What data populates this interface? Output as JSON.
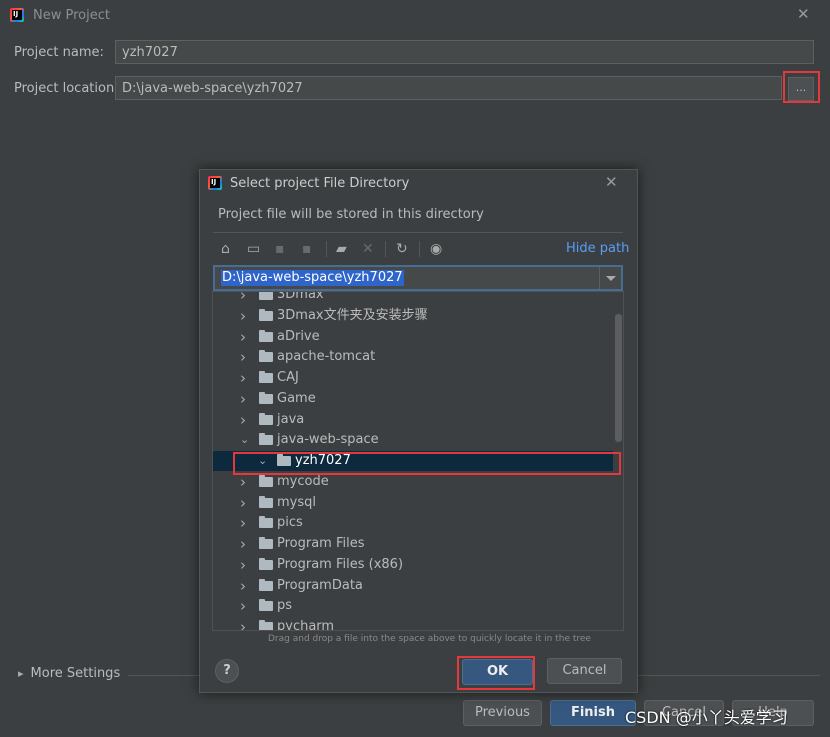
{
  "window": {
    "title": "New Project",
    "logo_text": "IJ",
    "close_glyph": "✕"
  },
  "form": {
    "name_label": "Project name:",
    "name_value": "yzh7027",
    "location_label": "Project location:",
    "location_value": "D:\\java-web-space\\yzh7027",
    "browse_label": "..."
  },
  "more_settings": {
    "label": "More Settings",
    "chevron_glyph": "▸"
  },
  "footer": {
    "previous": "Previous",
    "finish": "Finish",
    "cancel": "Cancel",
    "help": "Help"
  },
  "dialog": {
    "title": "Select project File Directory",
    "logo_text": "IJ",
    "close_glyph": "✕",
    "description": "Project file will be stored in this directory",
    "hide_path": "Hide path",
    "path_value": "D:\\java-web-space\\yzh7027",
    "hint": "Drag and drop a file into the space above to quickly locate it in the tree",
    "help_glyph": "?",
    "ok": "OK",
    "cancel": "Cancel",
    "toolbar": [
      {
        "icon": "home-icon",
        "glyph": "⌂",
        "enabled": true
      },
      {
        "icon": "desktop-icon",
        "glyph": "▭",
        "enabled": true
      },
      {
        "icon": "project-folder-icon",
        "glyph": "▪",
        "enabled": false
      },
      {
        "icon": "module-folder-icon",
        "glyph": "▪",
        "enabled": false
      },
      {
        "icon": "new-folder-icon",
        "glyph": "▰",
        "enabled": true
      },
      {
        "icon": "delete-icon",
        "glyph": "✕",
        "enabled": false
      },
      {
        "icon": "refresh-icon",
        "glyph": "↻",
        "enabled": true
      },
      {
        "icon": "show-hidden-icon",
        "glyph": "◉",
        "enabled": true
      }
    ],
    "tree": [
      {
        "label": "3Dmax",
        "level": 1,
        "expanded": false
      },
      {
        "label": "3Dmax文件夹及安装步骤",
        "level": 1,
        "expanded": false
      },
      {
        "label": "aDrive",
        "level": 1,
        "expanded": false
      },
      {
        "label": "apache-tomcat",
        "level": 1,
        "expanded": false
      },
      {
        "label": "CAJ",
        "level": 1,
        "expanded": false
      },
      {
        "label": "Game",
        "level": 1,
        "expanded": false
      },
      {
        "label": "java",
        "level": 1,
        "expanded": false
      },
      {
        "label": "java-web-space",
        "level": 1,
        "expanded": true
      },
      {
        "label": "yzh7027",
        "level": 2,
        "expanded": true,
        "selected": true
      },
      {
        "label": "mycode",
        "level": 1,
        "expanded": false
      },
      {
        "label": "mysql",
        "level": 1,
        "expanded": false
      },
      {
        "label": "pics",
        "level": 1,
        "expanded": false
      },
      {
        "label": "Program Files",
        "level": 1,
        "expanded": false
      },
      {
        "label": "Program Files (x86)",
        "level": 1,
        "expanded": false
      },
      {
        "label": "ProgramData",
        "level": 1,
        "expanded": false
      },
      {
        "label": "ps",
        "level": 1,
        "expanded": false
      },
      {
        "label": "pycharm",
        "level": 1,
        "expanded": false
      }
    ]
  },
  "watermark": "CSDN @小丫头爱学习",
  "colors": {
    "highlight_red": "#e4393c",
    "link_blue": "#589df6",
    "primary_button": "#365880",
    "selection": "#0d293e"
  }
}
